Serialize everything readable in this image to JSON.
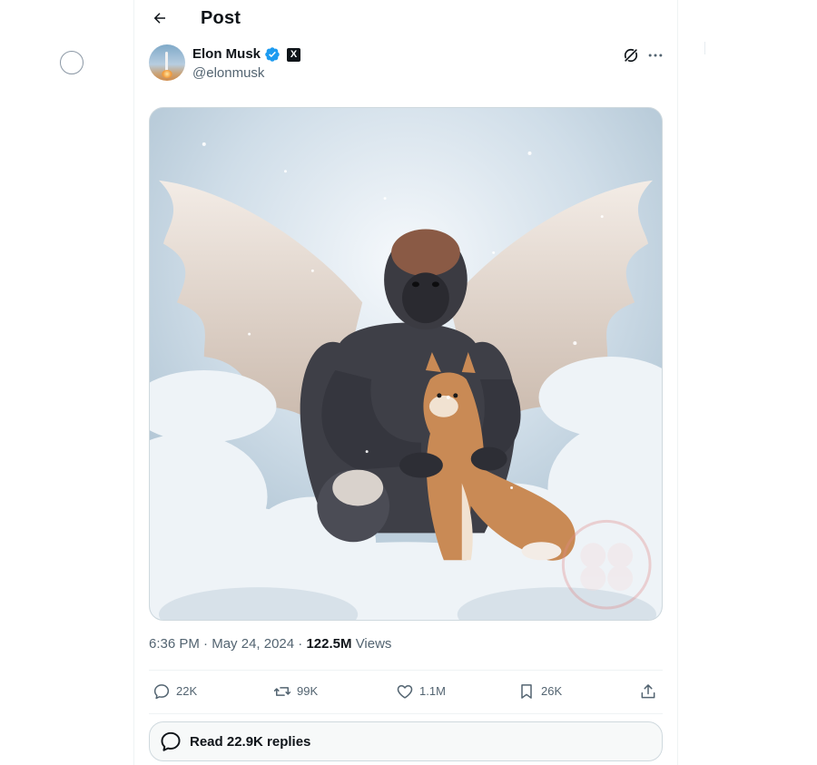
{
  "header": {
    "title": "Post"
  },
  "author": {
    "name": "Elon Musk",
    "handle": "@elonmusk",
    "badge": "X",
    "verified_color": "#1d9bf0"
  },
  "post": {
    "time": "6:36 PM",
    "date": "May 24, 2024",
    "views_count": "122.5M",
    "views_label": "Views",
    "separator": "·",
    "media_alt": "image"
  },
  "actions": {
    "replies": "22K",
    "reposts": "99K",
    "likes": "1.1M",
    "bookmarks": "26K"
  },
  "read_replies": {
    "label": "Read 22.9K replies"
  },
  "icons": [
    "back-arrow-icon",
    "verified-icon",
    "x-logo-icon",
    "grok-icon",
    "more-icon",
    "reply-icon",
    "repost-icon",
    "like-icon",
    "bookmark-icon",
    "share-icon",
    "chat-bubble-icon"
  ],
  "colors": {
    "text": "#0f1419",
    "secondary": "#536471",
    "border": "#cfd9de",
    "accent": "#1d9bf0"
  }
}
